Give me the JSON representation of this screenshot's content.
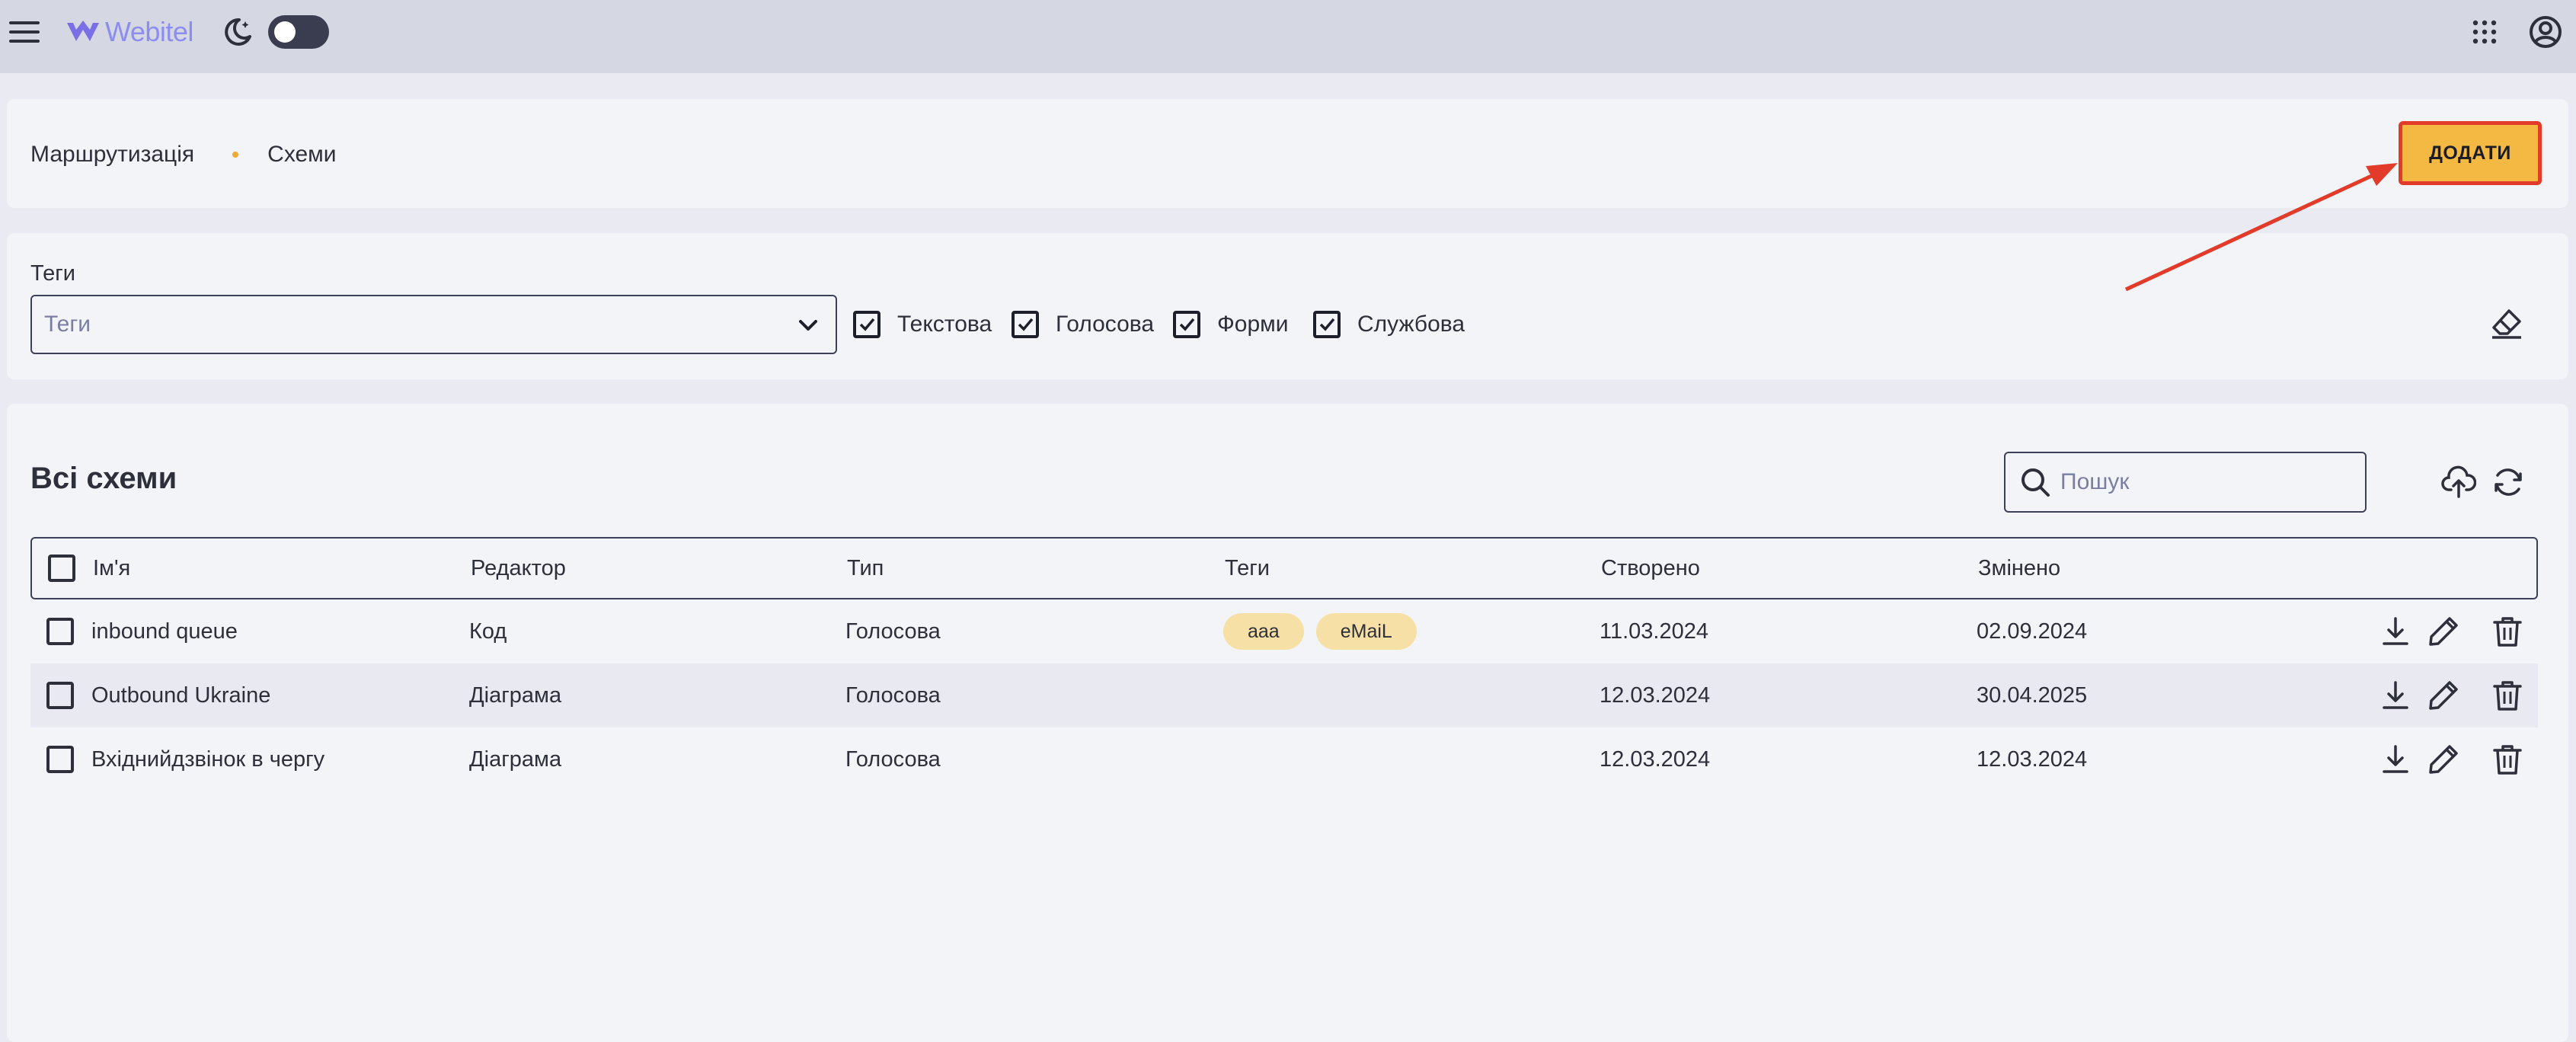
{
  "app": {
    "name": "Webitel"
  },
  "breadcrumb": {
    "parent": "Маршрутизація",
    "current": "Схеми"
  },
  "actions": {
    "add_label": "ДОДАТИ"
  },
  "filters": {
    "tags_label": "Теги",
    "tags_placeholder": "Теги",
    "types": [
      {
        "label": "Текстова",
        "checked": true
      },
      {
        "label": "Голосова",
        "checked": true
      },
      {
        "label": "Форми",
        "checked": true
      },
      {
        "label": "Службова",
        "checked": true
      }
    ]
  },
  "table": {
    "title": "Всі схеми",
    "search_placeholder": "Пошук",
    "columns": {
      "name": "Ім'я",
      "editor": "Редактор",
      "type": "Тип",
      "tags": "Теги",
      "created": "Створено",
      "modified": "Змінено"
    },
    "rows": [
      {
        "name": "inbound queue",
        "editor": "Код",
        "type": "Голосова",
        "tags": [
          "aaa",
          "eMaiL"
        ],
        "created": "11.03.2024",
        "modified": "02.09.2024"
      },
      {
        "name": "Outbound Ukraine",
        "editor": "Діаграма",
        "type": "Голосова",
        "tags": [],
        "created": "12.03.2024",
        "modified": "30.04.2025"
      },
      {
        "name": "Вхіднийдзвінок в чергу",
        "editor": "Діаграма",
        "type": "Голосова",
        "tags": [],
        "created": "12.03.2024",
        "modified": "12.03.2024"
      }
    ]
  },
  "colors": {
    "accent": "#f4b942",
    "highlight": "#e33b2a",
    "chip": "#f7e0a6",
    "logo": "#8b8ef0"
  },
  "icons": [
    "menu-icon",
    "logo-icon",
    "moon-icon",
    "apps-grid-icon",
    "account-icon",
    "chevron-down-icon",
    "eraser-icon",
    "search-icon",
    "upload-icon",
    "refresh-icon",
    "download-icon",
    "edit-icon",
    "delete-icon"
  ]
}
